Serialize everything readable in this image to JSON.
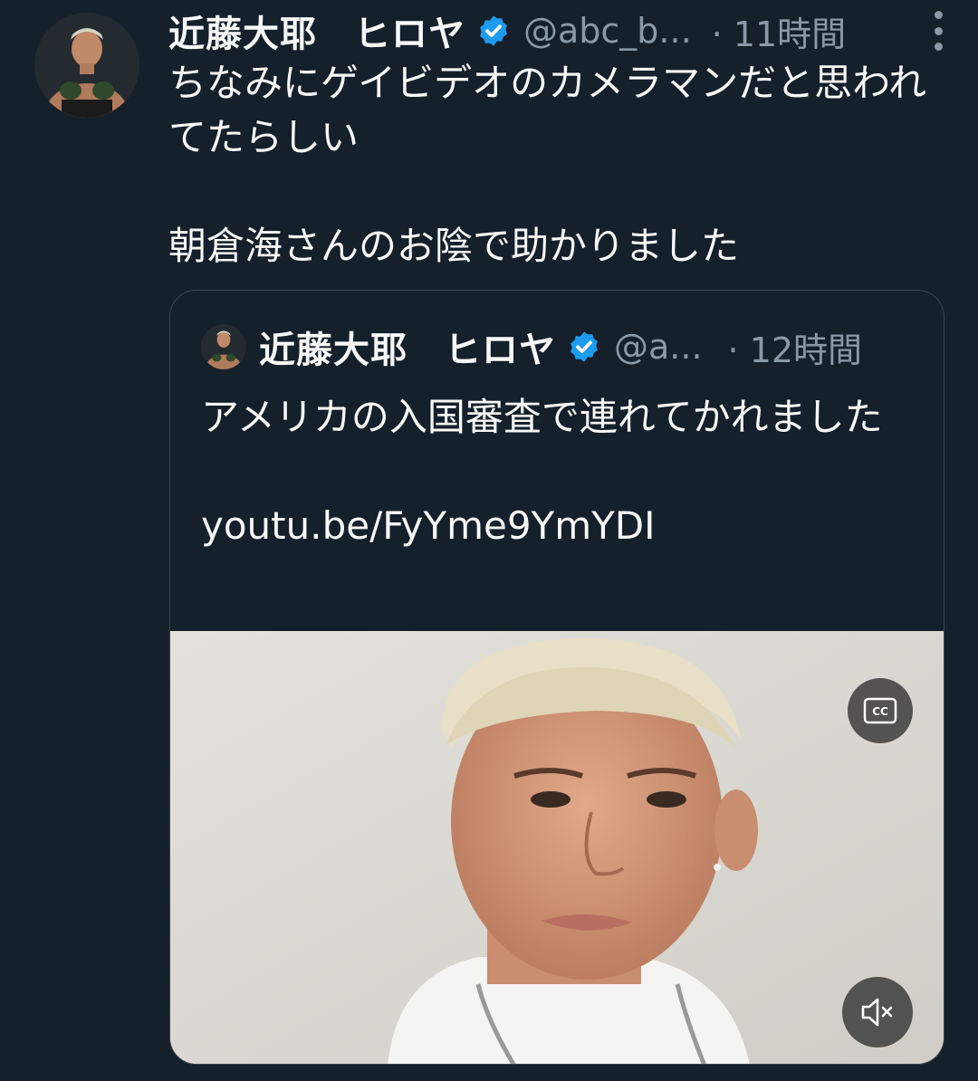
{
  "tweet": {
    "author": {
      "display_name": "近藤大耶　ヒロヤ",
      "handle": "@abc_b...",
      "verified": true,
      "avatar": "avatar-boxer"
    },
    "time": "· 11時間",
    "more_icon": "more-vertical-icon",
    "text": {
      "line1": "ちなみにゲイビデオのカメラマンだと思われてたらしい",
      "line2": "朝倉海さんのお陰で助かりました"
    }
  },
  "quoted_tweet": {
    "author": {
      "display_name": "近藤大耶　ヒロヤ",
      "handle": "@a...",
      "verified": true,
      "avatar": "avatar-boxer"
    },
    "time": "· 12時間",
    "text": {
      "line1": "アメリカの入国審査で連れてかれました",
      "link": "youtu.be/FyYme9YmYDI"
    },
    "media": {
      "type": "video",
      "cc_icon": "closed-captions-icon",
      "mute_icon": "volume-muted-icon"
    }
  },
  "colors": {
    "background": "#15202b",
    "text_primary": "#f7f9f9",
    "text_secondary": "#8b98a5",
    "verified_blue": "#1d9bf0",
    "border": "#38444d"
  }
}
